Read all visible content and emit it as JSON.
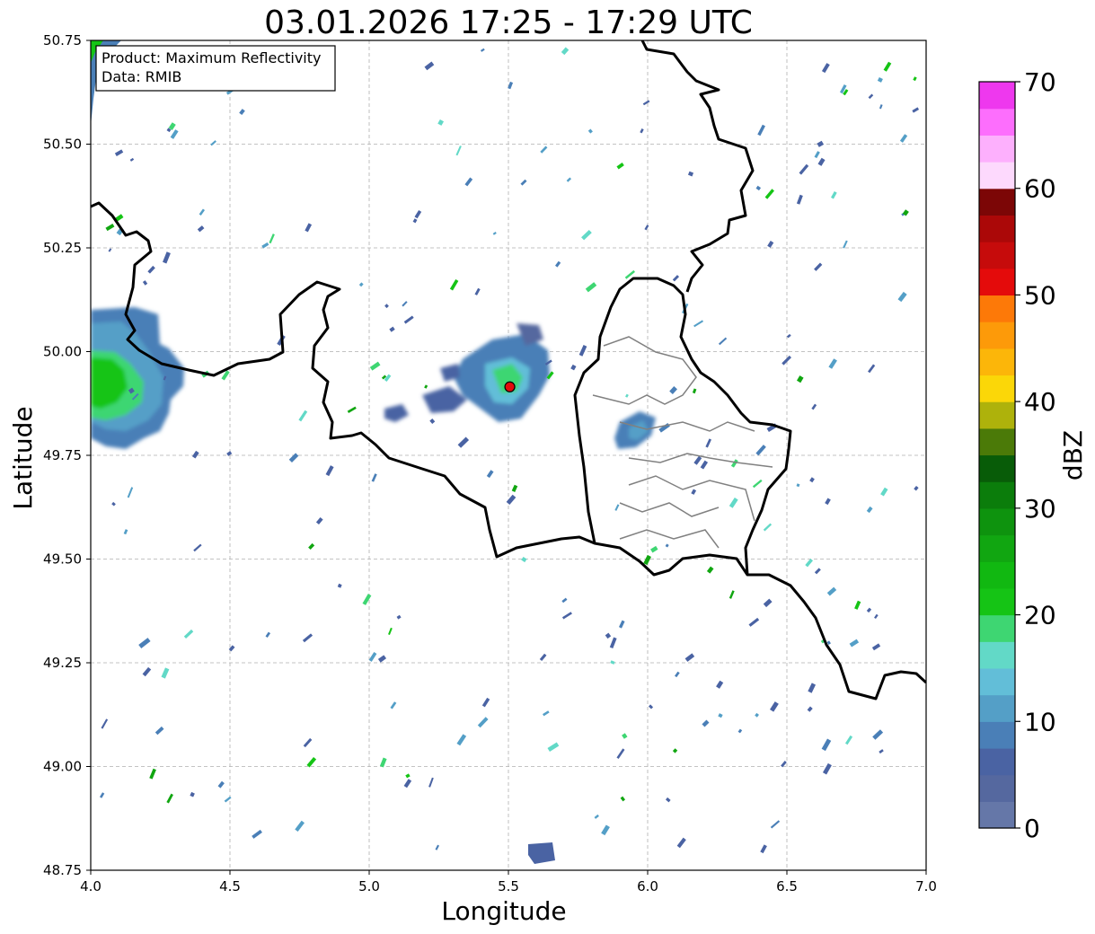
{
  "title": "03.01.2026 17:25 - 17:29 UTC",
  "info_box": {
    "product": "Product: Maximum Reflectivity",
    "data": "Data: RMIB"
  },
  "chart_data": {
    "type": "heatmap",
    "title": "03.01.2026 17:25 - 17:29 UTC",
    "xlabel": "Longitude",
    "ylabel": "Latitude",
    "xlim": [
      4.0,
      7.0
    ],
    "ylim": [
      48.75,
      50.75
    ],
    "x_ticks": [
      "4.0",
      "4.5",
      "5.0",
      "5.5",
      "6.0",
      "6.5",
      "7.0"
    ],
    "y_ticks": [
      "48.75",
      "49.00",
      "49.25",
      "49.50",
      "49.75",
      "50.00",
      "50.25",
      "50.50",
      "50.75"
    ],
    "grid": true,
    "radar_site": {
      "lon": 5.505,
      "lat": 49.915
    },
    "colorbar": {
      "label": "dBZ",
      "min": 0,
      "max": 70,
      "ticks": [
        "0",
        "10",
        "20",
        "30",
        "40",
        "50",
        "60",
        "70"
      ],
      "colors": [
        "#6577a8",
        "#55689f",
        "#4a63a3",
        "#4a7fb7",
        "#549fc7",
        "#62bed8",
        "#62d9c7",
        "#3ed672",
        "#15c415",
        "#11b811",
        "#11a611",
        "#0e930e",
        "#0b7d0b",
        "#085c08",
        "#4b7a08",
        "#aeb20b",
        "#fbd708",
        "#fcb609",
        "#fd9a09",
        "#fd7908",
        "#e40b0b",
        "#c60b0b",
        "#ab0808",
        "#7c0606",
        "#fdd9fd",
        "#fdb0fd",
        "#fd6efd",
        "#ee38ee"
      ]
    },
    "echoes": [
      {
        "lon": 4.12,
        "lat": 49.92,
        "dbz": 12,
        "area": "large"
      },
      {
        "lon": 4.09,
        "lat": 49.93,
        "dbz": 26,
        "area": "medium"
      },
      {
        "lon": 5.48,
        "lat": 49.94,
        "dbz": 10,
        "area": "medium"
      },
      {
        "lon": 5.52,
        "lat": 49.93,
        "dbz": 20,
        "area": "small"
      },
      {
        "lon": 5.96,
        "lat": 49.81,
        "dbz": 8,
        "area": "small"
      },
      {
        "lon": 5.61,
        "lat": 48.79,
        "dbz": 7,
        "area": "small"
      },
      {
        "lon": 4.03,
        "lat": 50.7,
        "dbz": 14,
        "area": "small"
      }
    ]
  }
}
